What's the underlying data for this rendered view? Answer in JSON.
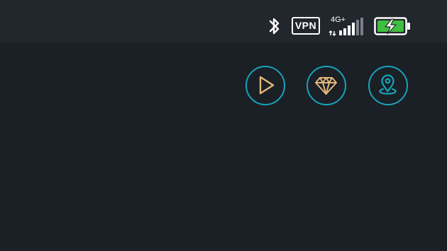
{
  "status_bar": {
    "bluetooth_icon": "bluetooth-icon",
    "vpn_label": "VPN",
    "network_label": "4G+",
    "signal_icon": "cellular-signal-icon",
    "battery_icon": "battery-charging-icon"
  },
  "actions": [
    {
      "name": "play",
      "icon": "play-icon"
    },
    {
      "name": "premium",
      "icon": "diamond-icon"
    },
    {
      "name": "location",
      "icon": "location-pin-icon"
    }
  ],
  "colors": {
    "background": "#1b1f26",
    "status_bar": "#22262d",
    "accent_ring": "#16a4b9",
    "icon_stroke": "#e2b87a",
    "battery_fill": "#3fbf3f"
  }
}
